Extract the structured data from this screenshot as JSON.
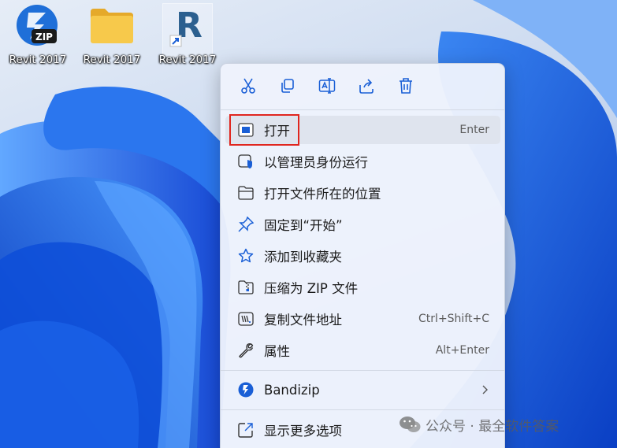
{
  "desktop": {
    "icons": [
      {
        "caption": "Revit 2017",
        "icon": "zip-archive-icon",
        "badge": "ZIP"
      },
      {
        "caption": "Revit 2017",
        "icon": "folder-icon"
      },
      {
        "caption": "Revit 2017",
        "icon": "revit-shortcut-icon",
        "letter": "R"
      }
    ]
  },
  "context_menu": {
    "quick_actions": [
      {
        "icon": "cut-icon"
      },
      {
        "icon": "copy-icon"
      },
      {
        "icon": "rename-icon"
      },
      {
        "icon": "share-icon"
      },
      {
        "icon": "delete-icon"
      }
    ],
    "items": [
      {
        "label": "打开",
        "shortcut": "Enter",
        "icon": "open-icon",
        "highlighted": true
      },
      {
        "label": "以管理员身份运行",
        "shortcut": "",
        "icon": "run-as-admin-icon"
      },
      {
        "label": "打开文件所在的位置",
        "shortcut": "",
        "icon": "folder-open-icon"
      },
      {
        "label": "固定到“开始”",
        "shortcut": "",
        "icon": "pin-icon"
      },
      {
        "label": "添加到收藏夹",
        "shortcut": "",
        "icon": "star-icon"
      },
      {
        "label": "压缩为 ZIP 文件",
        "shortcut": "",
        "icon": "zip-folder-icon"
      },
      {
        "label": "复制文件地址",
        "shortcut": "Ctrl+Shift+C",
        "icon": "copy-path-icon"
      },
      {
        "label": "属性",
        "shortcut": "Alt+Enter",
        "icon": "wrench-icon"
      },
      {
        "label": "Bandizip",
        "shortcut": "",
        "icon": "bandizip-icon"
      },
      {
        "label": "显示更多选项",
        "shortcut": "",
        "icon": "more-options-icon"
      }
    ]
  },
  "watermark": {
    "text": "公众号 · 最全软件答案",
    "icon": "wechat-icon"
  },
  "colors": {
    "highlight_border": "#e0261f",
    "accent": "#1a5fd6",
    "menu_bg": "#eef2fc"
  }
}
